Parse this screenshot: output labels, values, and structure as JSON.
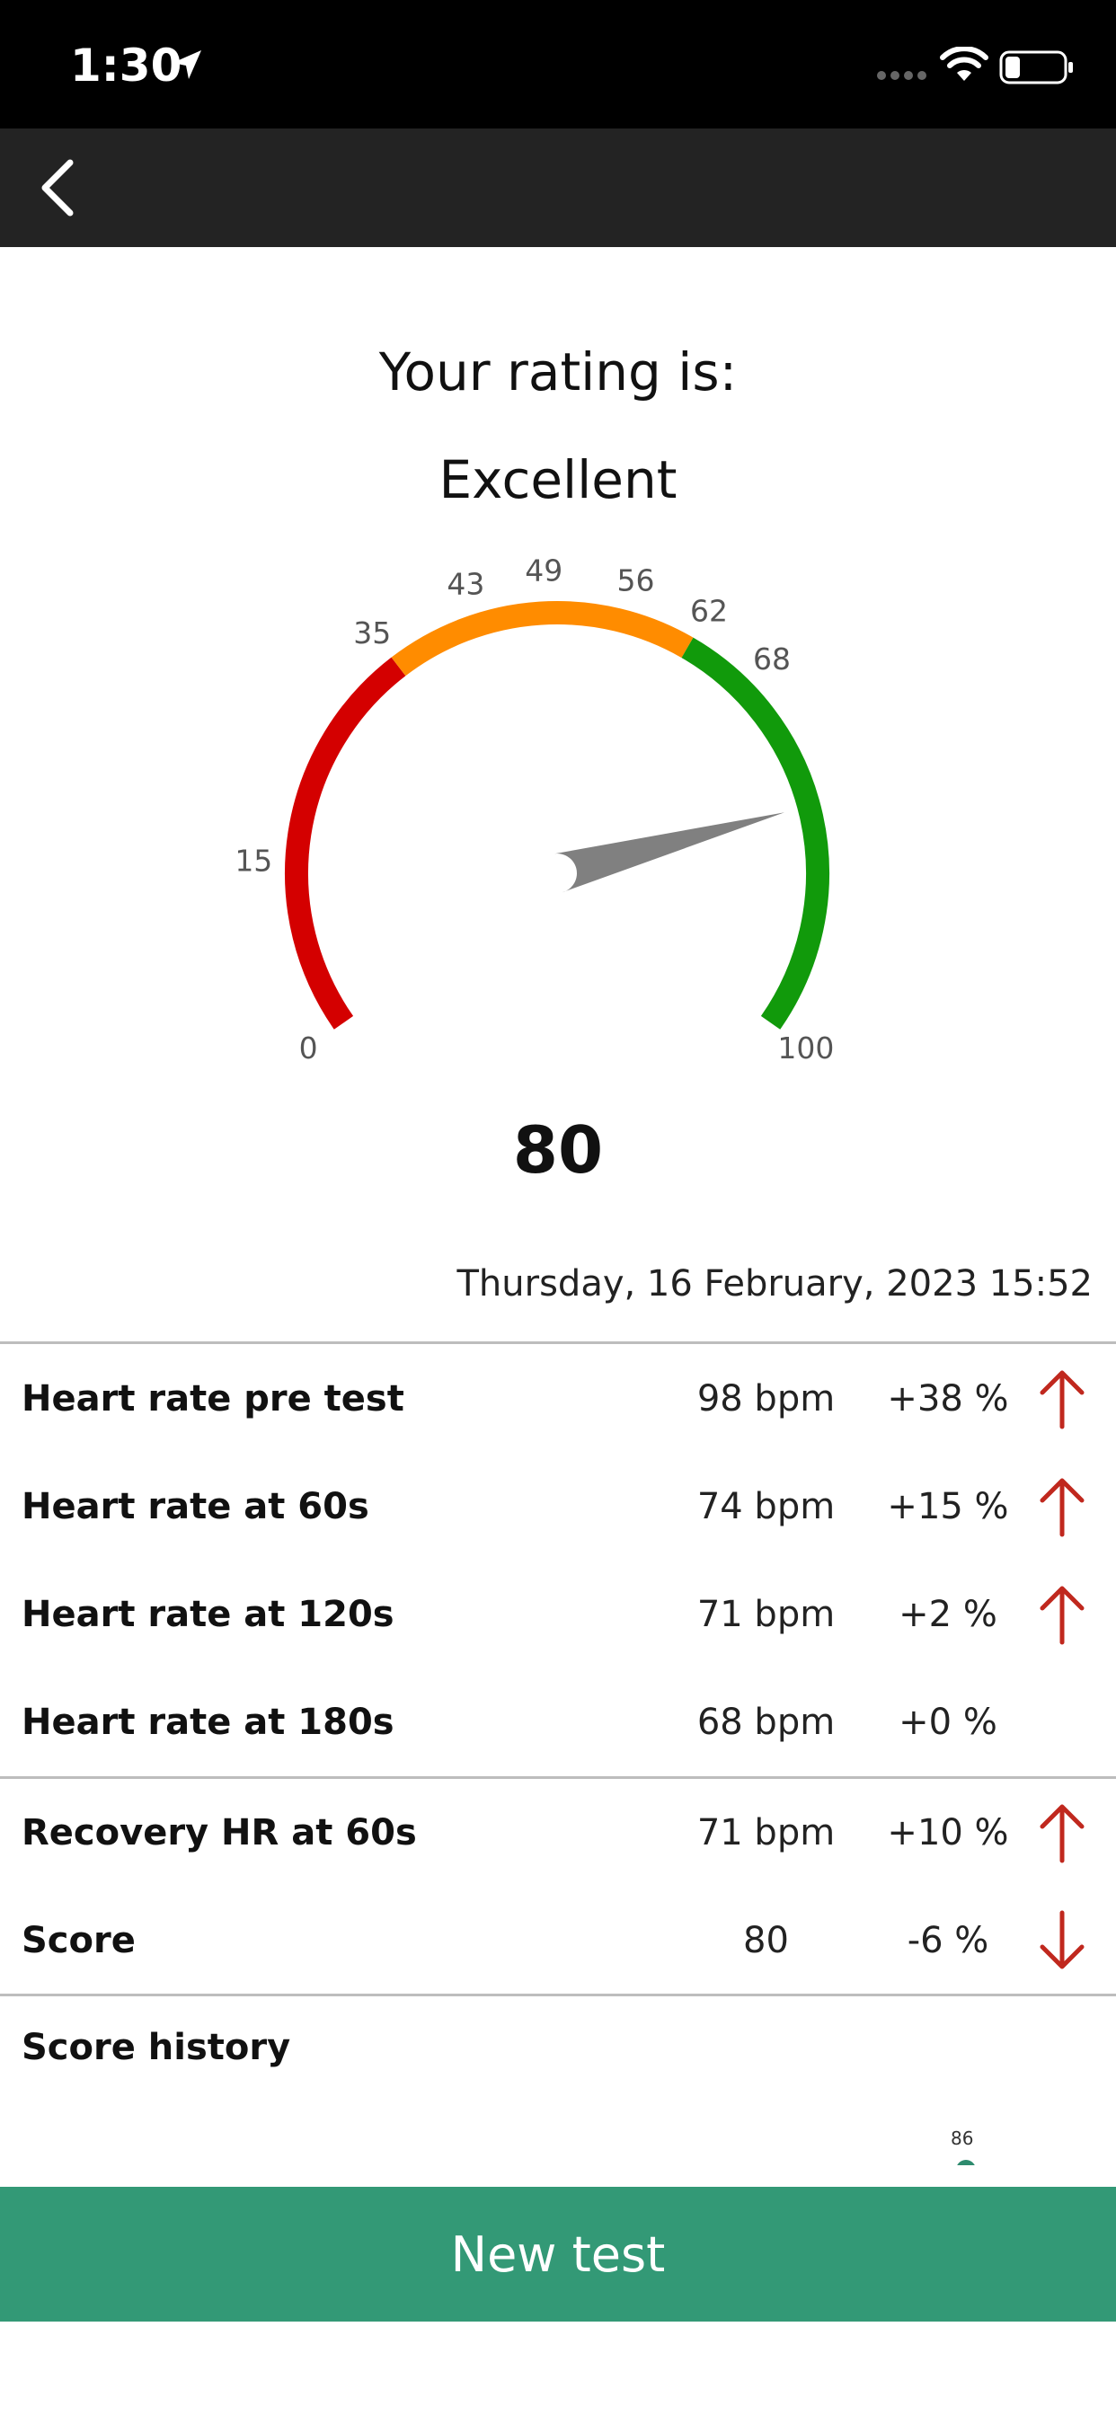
{
  "status_bar": {
    "time": "1:30",
    "location_icon": "location-arrow-icon",
    "wifi_icon": "wifi-icon",
    "battery_icon": "battery-icon"
  },
  "nav": {
    "back_icon": "chevron-left-icon"
  },
  "rating": {
    "heading": "Your rating is:",
    "value": "Excellent"
  },
  "gauge": {
    "value": 80,
    "min": 0,
    "max": 100,
    "ticks": [
      "0",
      "15",
      "35",
      "43",
      "49",
      "56",
      "62",
      "68",
      "100"
    ],
    "zones": [
      {
        "from": 0,
        "to": 35,
        "color": "#d40000"
      },
      {
        "from": 35,
        "to": 62,
        "color": "#ff8c00"
      },
      {
        "from": 62,
        "to": 100,
        "color": "#119a0b"
      }
    ],
    "needle_color": "#808080"
  },
  "timestamp": "Thursday, 16 February, 2023 15:52",
  "results": [
    {
      "label": "Heart rate pre test",
      "value": "98 bpm",
      "change": "+38 %",
      "arrow": "up"
    },
    {
      "label": "Heart rate at 60s",
      "value": "74 bpm",
      "change": "+15 %",
      "arrow": "up"
    },
    {
      "label": "Heart rate at 120s",
      "value": "71 bpm",
      "change": "+2 %",
      "arrow": "up"
    },
    {
      "label": "Heart rate at 180s",
      "value": "68 bpm",
      "change": "+0 %",
      "arrow": "none"
    }
  ],
  "recovery": [
    {
      "label": "Recovery HR at 60s",
      "value": "71 bpm",
      "change": "+10 %",
      "arrow": "up"
    },
    {
      "label": "Score",
      "value": "80",
      "change": "-6 %",
      "arrow": "down"
    }
  ],
  "history": {
    "title": "Score history",
    "last_point_label": "86"
  },
  "colors": {
    "accent": "#339976",
    "arrow": "#c0281e",
    "navbar": "#232323"
  },
  "actions": {
    "new_test_label": "New test"
  }
}
